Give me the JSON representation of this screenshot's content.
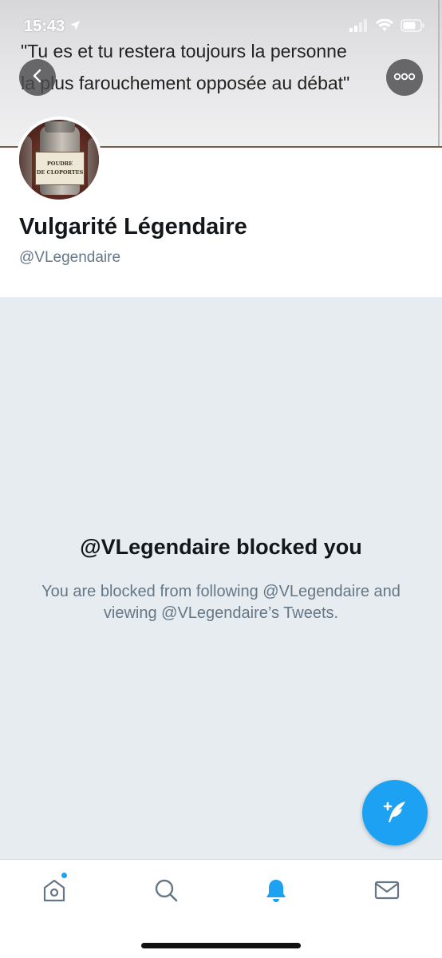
{
  "status_bar": {
    "time": "15:43",
    "location_icon": "location-arrow-icon",
    "signal_icon": "cellular-signal-icon",
    "wifi_icon": "wifi-icon",
    "battery_icon": "battery-icon"
  },
  "banner": {
    "quote_line1": "\"Tu es et tu restera toujours la personne",
    "quote_line2": "la plus farouchement opposée au débat\""
  },
  "header": {
    "back_icon": "chevron-left-icon",
    "more_icon": "more-horizontal-icon"
  },
  "avatar": {
    "label_line1": "POUDRE",
    "label_line2": "DE CLOPORTES"
  },
  "profile": {
    "display_name": "Vulgarité Légendaire",
    "handle": "@VLegendaire"
  },
  "blocked": {
    "title": "@VLegendaire blocked you",
    "description": "You are blocked from following @VLegendaire and viewing @VLegendaire’s Tweets."
  },
  "fab": {
    "icon": "compose-tweet-icon",
    "color": "#1da1f2"
  },
  "tabbar": {
    "items": [
      {
        "name": "home",
        "icon": "home-icon",
        "active": false,
        "has_dot": true
      },
      {
        "name": "search",
        "icon": "search-icon",
        "active": false
      },
      {
        "name": "notifications",
        "icon": "bell-icon",
        "active": true
      },
      {
        "name": "messages",
        "icon": "envelope-icon",
        "active": false
      }
    ],
    "accent_color": "#1da1f2",
    "inactive_color": "#657786"
  }
}
